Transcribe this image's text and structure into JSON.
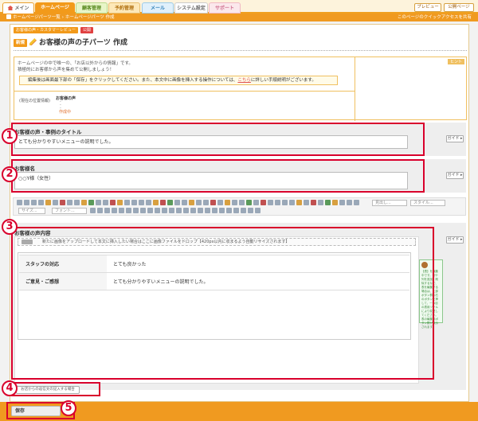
{
  "tabs": [
    {
      "label": "メイン"
    },
    {
      "label": "ホームページ"
    },
    {
      "label": "顧客管理"
    },
    {
      "label": "予約管理"
    },
    {
      "label": "メール"
    },
    {
      "label": "システム設定"
    },
    {
      "label": "サポート"
    }
  ],
  "top_buttons": {
    "preview": "プレビュー",
    "public": "公開ページ"
  },
  "breadcrumb": {
    "items": [
      "ホームページパーツ一覧",
      "ホームページパーツ 作成"
    ],
    "quick_access": "このページのクイックアクセスを共有"
  },
  "subhead": {
    "category": "お客様の声・カスタマーレビュー",
    "status": "公開"
  },
  "page": {
    "new_badge": "新規",
    "title": "お客様の声の子パーツ 作成"
  },
  "info": {
    "line1": "ホームページの中で唯一の、「お店以外からの情報」です。",
    "line2": "積極的にお客様から声を集めて公開しましょう！",
    "notice_prefix": "編集後は画面最下部の「保存」をクリックしてください。また、本文中に画像を挿入する操作については、",
    "notice_link": "こちら",
    "notice_suffix": "に詳しい手順説明がございます。",
    "hint_tag": "ヒント",
    "location_label": "(現在の位置情報)",
    "location_page": "お客様の声",
    "location_create": "作成中"
  },
  "sections": {
    "title_label": "お客様の声・事例のタイトル",
    "title_value": "とても分かりやすいメニューの説明でした。",
    "name_label": "お客様名",
    "name_value": "○○Y様（女性）",
    "content_label": "お客様の声内容",
    "guide": "ガイド ▸"
  },
  "toolbar": {
    "style_select": "スタイル...",
    "format_select": "見出し...",
    "size_select": "サイズ...",
    "font_select": "フォント..."
  },
  "content": {
    "upload_text": "新たに画像をアップロードして本文に挿入したい場合はここに画像ファイルをドロップ【420px以内に収まるよう自動リサイズされます】",
    "rows": [
      {
        "label": "スタッフの対応",
        "value": "とても良かった"
      },
      {
        "label": "ご意見・ご感想",
        "value": "とても分かりやすいメニューの説明でした。"
      }
    ],
    "side_note": "【表】を編集中です。行や列を追加、削除するなど、表を編集する場合は、上部ボタン群の右のボタンを押して、一つ目の表用ツールにより変更してください。表の編集用ボタン群が表示されます。"
  },
  "suggest_button": "お店からの返信文の記入する場合",
  "save_button": "保存",
  "callouts": [
    "1",
    "2",
    "3",
    "4",
    "5"
  ]
}
